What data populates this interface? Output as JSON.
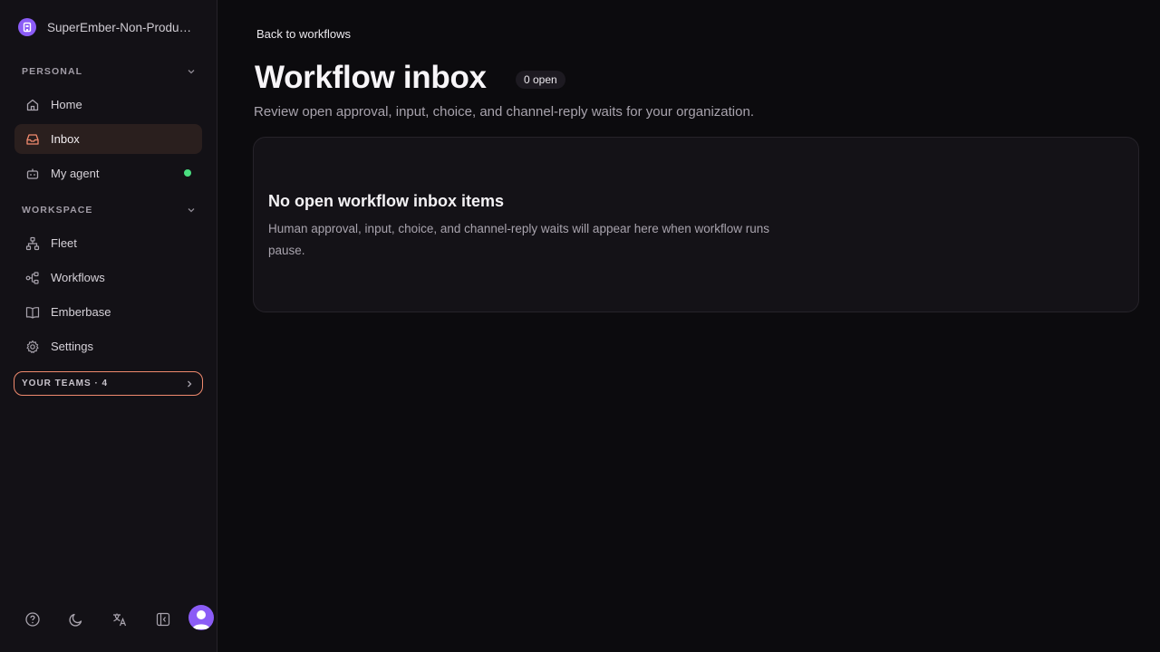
{
  "sidebar": {
    "org_name": "SuperEmber-Non-Production",
    "personal_label": "PERSONAL",
    "personal_items": [
      {
        "label": "Home",
        "icon": "home-icon"
      },
      {
        "label": "Inbox",
        "icon": "inbox-icon",
        "active": true
      },
      {
        "label": "My agent",
        "icon": "bot-icon",
        "status": "online"
      }
    ],
    "workspace_label": "WORKSPACE",
    "workspace_items": [
      {
        "label": "Fleet",
        "icon": "network-icon"
      },
      {
        "label": "Workflows",
        "icon": "workflow-icon"
      },
      {
        "label": "Emberbase",
        "icon": "book-icon"
      },
      {
        "label": "Settings",
        "icon": "gear-icon"
      }
    ],
    "teams_label": "YOUR TEAMS · 4",
    "footer_icons": [
      "help-icon",
      "moon-icon",
      "translate-icon",
      "sidebar-collapse-icon",
      "user-avatar"
    ]
  },
  "main": {
    "back_link": "Back to workflows",
    "title": "Workflow inbox",
    "open_badge": "0 open",
    "subtitle": "Review open approval, input, choice, and channel-reply waits for your organization.",
    "empty_title": "No open workflow inbox items",
    "empty_desc": "Human approval, input, choice, and channel-reply waits will appear here when workflow runs pause."
  },
  "colors": {
    "accent": "#f08a6e",
    "avatar": "#8b5cf6",
    "status_online": "#4ade80",
    "background": "#0c0b0e"
  }
}
